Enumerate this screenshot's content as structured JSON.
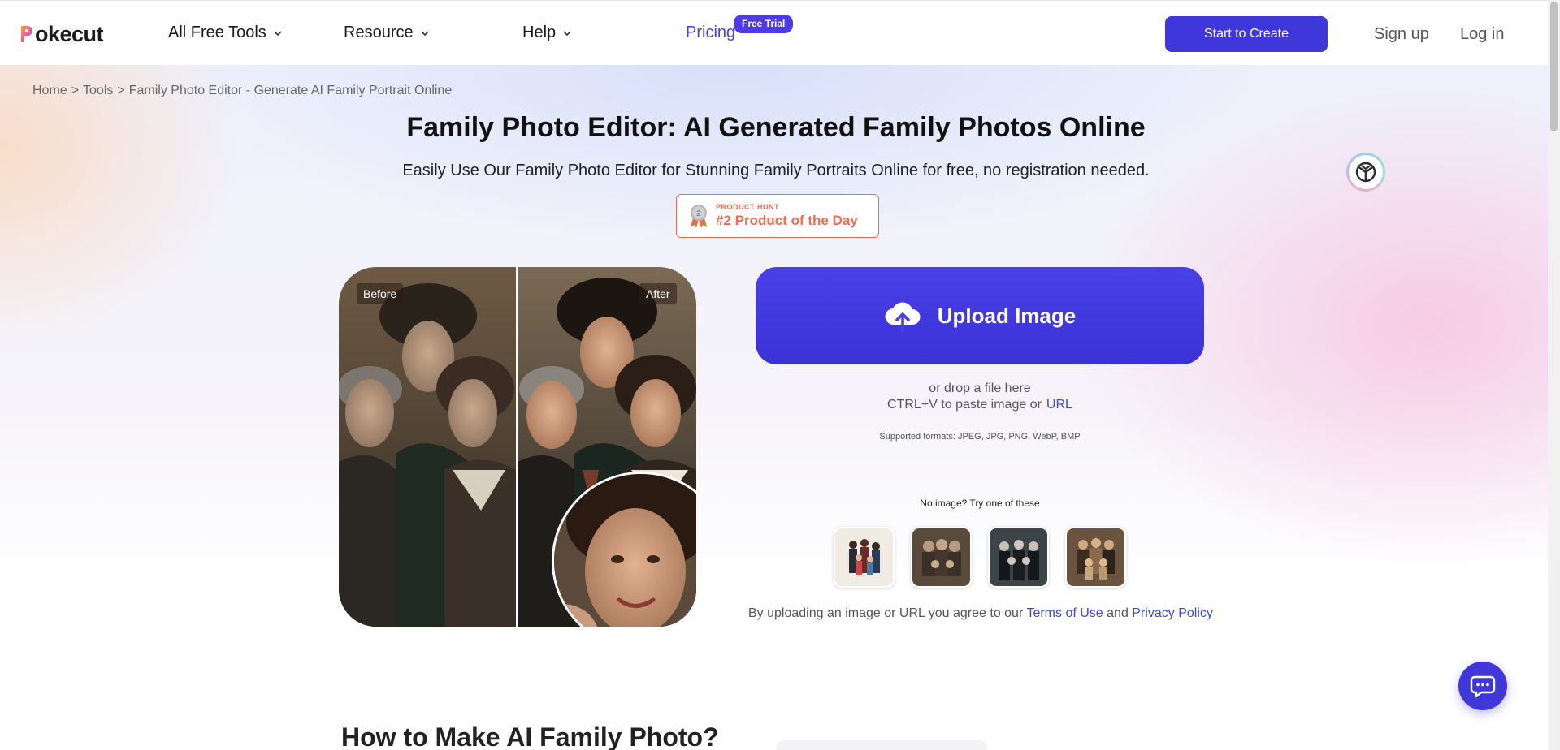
{
  "header": {
    "logo_text": "okecut",
    "nav": {
      "all_free_tools": "All Free Tools",
      "resource": "Resource",
      "help": "Help",
      "pricing": "Pricing",
      "pricing_badge": "Free Trial"
    },
    "cta_label": "Start to Create",
    "sign_up": "Sign up",
    "log_in": "Log in"
  },
  "breadcrumb": {
    "home": "Home",
    "sep1": ">",
    "tools": "Tools",
    "sep2": ">",
    "current": "Family Photo Editor - Generate AI Family Portrait Online"
  },
  "hero": {
    "title": "Family Photo Editor: AI Generated Family Photos Online",
    "subtitle": "Easily Use Our Family Photo Editor for Stunning Family Portraits Online for free, no registration needed.",
    "product_hunt": {
      "label": "PRODUCT HUNT",
      "title": "#2 Product of the Day",
      "rank": "2"
    }
  },
  "before_after": {
    "before_label": "Before",
    "after_label": "After"
  },
  "upload": {
    "button_label": "Upload Image",
    "drop_text": "or drop a file here",
    "paste_text": "CTRL+V to paste image or",
    "url_label": "URL",
    "formats": "Supported formats: JPEG, JPG, PNG, WebP, BMP",
    "try_text": "No image? Try one of these"
  },
  "agreement": {
    "prefix": "By uploading an image or URL you agree to our",
    "terms": "Terms of Use",
    "and": "and",
    "privacy": "Privacy Policy"
  },
  "section": {
    "how_title": "How to Make AI Family Photo?"
  },
  "colors": {
    "brand": "#3f37d9",
    "link": "#3b48d8",
    "product_hunt": "#f06b4f"
  },
  "icons": [
    "chevron-down-icon",
    "upload-cloud-icon",
    "medal-icon",
    "chat-icon",
    "assistant-icon"
  ]
}
